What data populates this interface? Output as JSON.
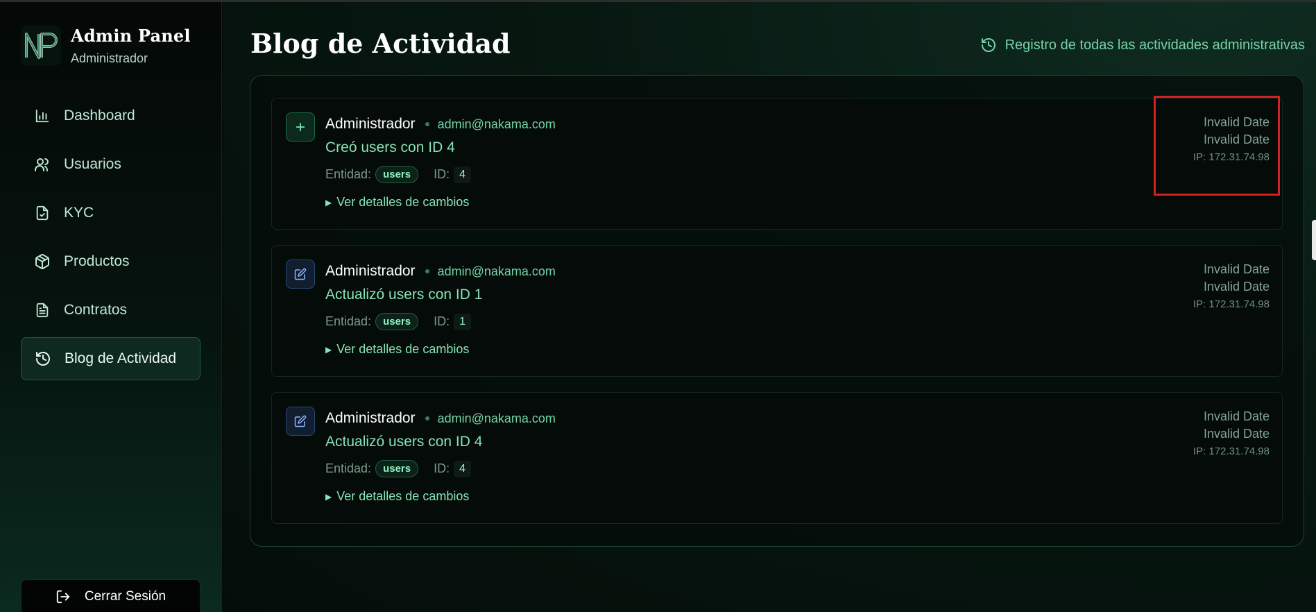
{
  "sidebar": {
    "brand_title": "Admin Panel",
    "brand_subtitle": "Administrador",
    "items": [
      {
        "label": "Dashboard",
        "icon": "bar-chart-icon"
      },
      {
        "label": "Usuarios",
        "icon": "users-icon"
      },
      {
        "label": "KYC",
        "icon": "file-check-icon"
      },
      {
        "label": "Productos",
        "icon": "package-icon"
      },
      {
        "label": "Contratos",
        "icon": "file-text-icon"
      },
      {
        "label": "Blog de Actividad",
        "icon": "history-icon",
        "active": true
      }
    ],
    "logout_label": "Cerrar Sesión"
  },
  "header": {
    "title": "Blog de Actividad",
    "subtitle": "Registro de todas las actividades administrativas"
  },
  "labels": {
    "entity": "Entidad:",
    "id": "ID:",
    "details": "Ver detalles de cambios"
  },
  "activities": [
    {
      "type": "create",
      "icon": "plus-icon",
      "admin": "Administrador",
      "email": "admin@nakama.com",
      "action": "Creó users con ID 4",
      "entity": "users",
      "id": "4",
      "date_line1": "Invalid Date",
      "date_line2": "Invalid Date",
      "ip": "IP: 172.31.74.98"
    },
    {
      "type": "update",
      "icon": "edit-icon",
      "admin": "Administrador",
      "email": "admin@nakama.com",
      "action": "Actualizó users con ID 1",
      "entity": "users",
      "id": "1",
      "date_line1": "Invalid Date",
      "date_line2": "Invalid Date",
      "ip": "IP: 172.31.74.98"
    },
    {
      "type": "update",
      "icon": "edit-icon",
      "admin": "Administrador",
      "email": "admin@nakama.com",
      "action": "Actualizó users con ID 4",
      "entity": "users",
      "id": "4",
      "date_line1": "Invalid Date",
      "date_line2": "Invalid Date",
      "ip": "IP: 172.31.74.98"
    }
  ],
  "colors": {
    "accent": "#74d3a6",
    "highlight_box": "#d42020"
  }
}
